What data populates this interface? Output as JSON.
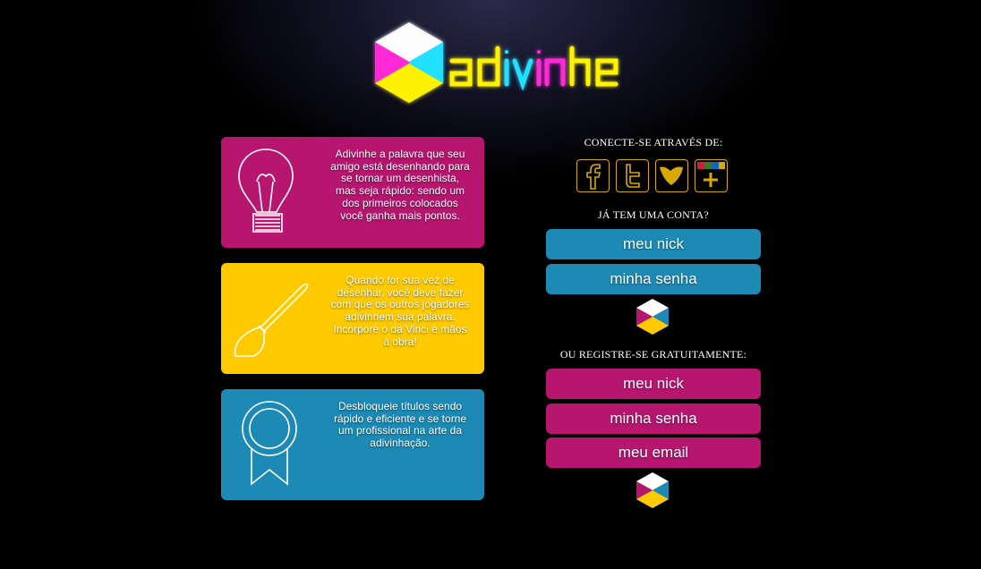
{
  "logo": {
    "text": "adivinhe"
  },
  "cards": [
    {
      "text": "Adivinhe a palavra que seu amigo está desenhando para se tornar um desenhista, mas seja rápido: sendo um dos primeiros colocados você ganha mais pontos.",
      "color": "#b7166f",
      "icon": "lightbulb-icon"
    },
    {
      "text": "Quando for sua vez de desenhar, você deve fazer com que os outros jogadores adivinhem sua palavra. Incorpore o da Vinci e mãos à obra!",
      "color": "#ffcb00",
      "icon": "brush-icon"
    },
    {
      "text": "Desbloqueie títulos sendo rápido e eficiente e se torne um profissional na arte da adivinhação.",
      "color": "#1c8ab5",
      "icon": "award-ribbon-icon"
    }
  ],
  "connect": {
    "heading": "CONECTE-SE ATRAVÉS DE:",
    "networks": [
      "facebook-icon",
      "twitter-icon",
      "windows-live-icon",
      "google-plus-icon"
    ]
  },
  "login": {
    "heading": "JÁ TEM UMA CONTA?",
    "nick_placeholder": "meu nick",
    "password_placeholder": "minha senha"
  },
  "register": {
    "heading": "OU REGISTRE-SE GRATUITAMENTE:",
    "nick_placeholder": "meu nick",
    "password_placeholder": "minha senha",
    "email_placeholder": "meu email"
  },
  "colors": {
    "pink": "#b7166f",
    "yellow": "#ffcb00",
    "blue": "#1c8ab5",
    "gold": "#d8a900"
  }
}
